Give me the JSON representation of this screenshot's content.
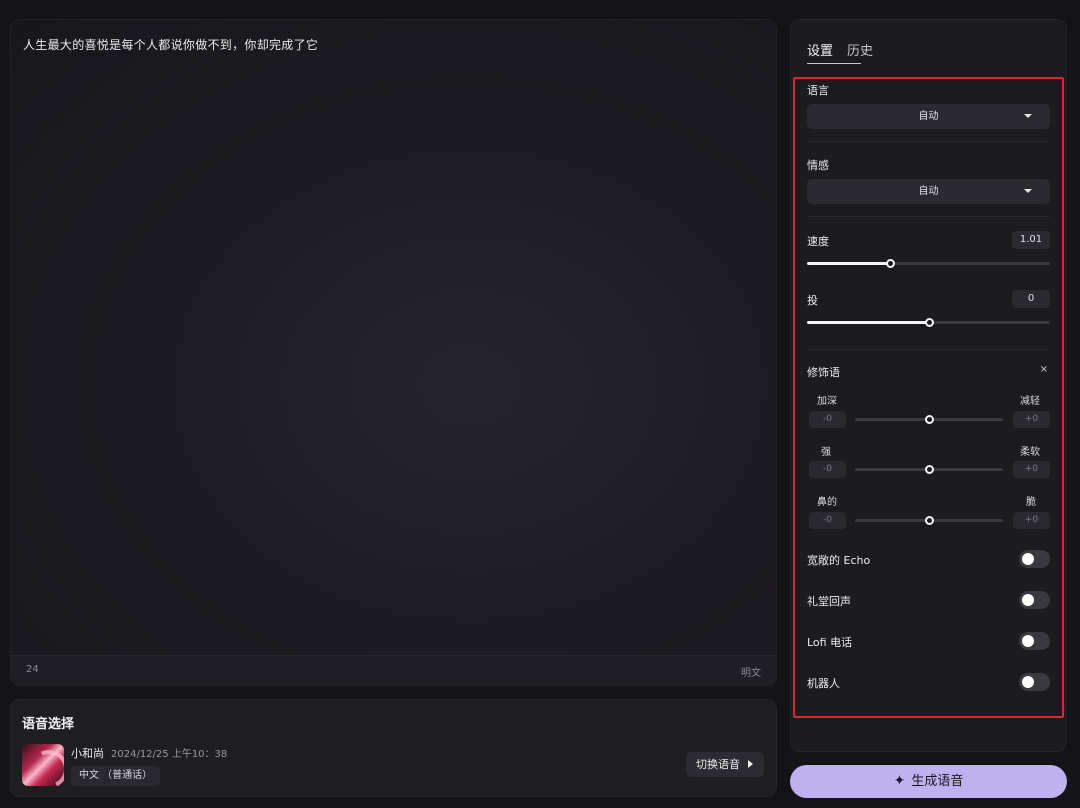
{
  "editor": {
    "text": "人生最大的喜悦是每个人都说你做不到，你却完成了它",
    "char_count": "24",
    "mode_label": "明文"
  },
  "voice_panel": {
    "title": "语音选择",
    "voice_name": "小和尚",
    "voice_date": "2024/12/25 上午10：38",
    "voice_tag": "中文 （普通话）",
    "switch_label": "切换语音"
  },
  "settings": {
    "tabs": [
      "设置",
      "历史"
    ],
    "language": {
      "label": "语言",
      "value": "自动"
    },
    "emotion": {
      "label": "情感",
      "value": "自动"
    },
    "speed": {
      "label": "速度",
      "value": "1.01",
      "fill_fraction": 0.34
    },
    "pitch": {
      "label": "投",
      "value": "0",
      "fill_fraction": 0.5
    },
    "modifiers": {
      "title": "修饰语",
      "rows": [
        {
          "left": "加深",
          "right": "减轻",
          "left_value": "-0",
          "right_value": "+0",
          "position": 0.5
        },
        {
          "left": "强",
          "right": "柔软",
          "left_value": "-0",
          "right_value": "+0",
          "position": 0.5
        },
        {
          "left": "鼻的",
          "right": "脆",
          "left_value": "-0",
          "right_value": "+0",
          "position": 0.5
        }
      ]
    },
    "toggles": [
      {
        "label": "宽敞的 Echo",
        "on": false
      },
      {
        "label": "礼堂回声",
        "on": false
      },
      {
        "label": "Lofi 电话",
        "on": false
      },
      {
        "label": "机器人",
        "on": false
      }
    ]
  },
  "generate_label": "生成语音",
  "colors": {
    "accent": "#bfb0ef",
    "highlight_border": "#e0252b"
  }
}
